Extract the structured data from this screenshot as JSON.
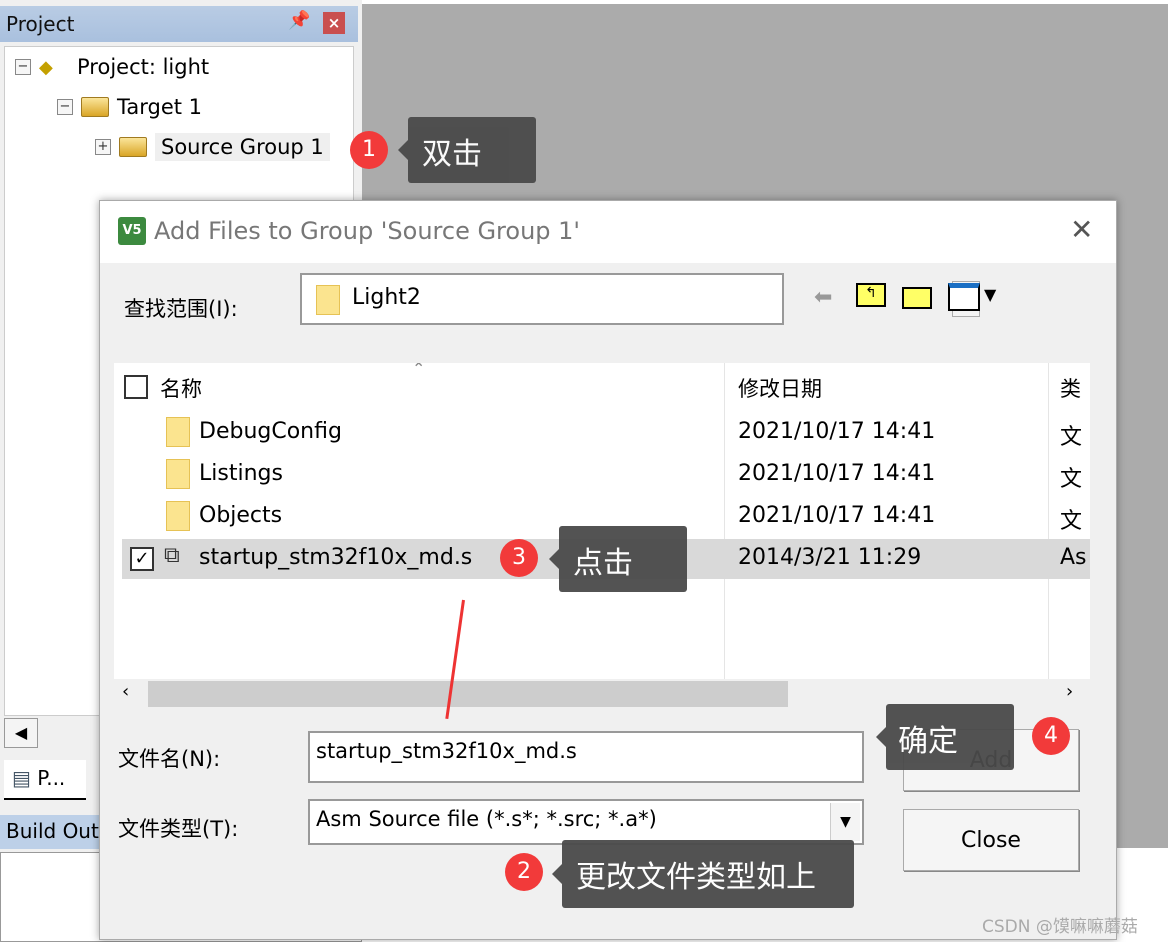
{
  "project_panel": {
    "title": "Project",
    "pin_icon": "pin-icon",
    "close_icon": "close-icon",
    "tree": [
      {
        "label": "Project: light"
      },
      {
        "label": "Target 1"
      },
      {
        "label": "Source Group 1"
      }
    ],
    "tab_label": "P...",
    "build_output": "Build Out"
  },
  "dialog": {
    "title": "Add Files to Group 'Source Group 1'",
    "look_in_label": "查找范围(I):",
    "look_in_value": "Light2",
    "columns": [
      "名称",
      "修改日期",
      "类"
    ],
    "rows": [
      {
        "name": "DebugConfig",
        "date": "2021/10/17 14:41",
        "type": "文",
        "checked": false
      },
      {
        "name": "Listings",
        "date": "2021/10/17 14:41",
        "type": "文",
        "checked": false
      },
      {
        "name": "Objects",
        "date": "2021/10/17 14:41",
        "type": "文",
        "checked": false
      },
      {
        "name": "startup_stm32f10x_md.s",
        "date": "2014/3/21 11:29",
        "type": "As",
        "checked": true
      }
    ],
    "filename_label": "文件名(N):",
    "filename_value": "startup_stm32f10x_md.s",
    "filetype_label": "文件类型(T):",
    "filetype_value": "Asm Source file (*.s*; *.src; *.a*)",
    "add_button": "Add",
    "close_button": "Close"
  },
  "annotations": [
    {
      "num": "1",
      "text": "双击"
    },
    {
      "num": "2",
      "text": "更改文件类型如上"
    },
    {
      "num": "3",
      "text": "点击"
    },
    {
      "num": "4",
      "text": "确定"
    }
  ],
  "accent_color": "#f23a3a",
  "watermark": "CSDN @馍嘛嘛蘑菇"
}
